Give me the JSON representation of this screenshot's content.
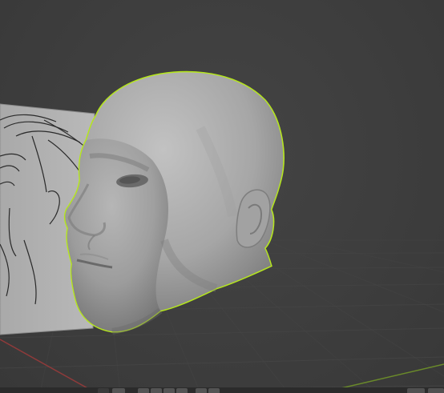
{
  "window": {
    "app": "blender",
    "view": "3d-viewport",
    "mode": "object-mode"
  },
  "scene": {
    "selected_object": "head-sculpt",
    "reference_image": "face-sketch-reference",
    "selection_outline_color": "#b5e61d",
    "background_color": "#3d3d3d",
    "grid_color": "#4a4a4a",
    "x_axis_color": "#8f3a3a",
    "y_axis_color": "#6a8a2a"
  },
  "toolbar": {
    "buttons": [
      {
        "icon": "tool-icon"
      },
      {
        "icon": "select-icon"
      },
      {
        "icon": "move-icon"
      },
      {
        "icon": "rotate-icon"
      },
      {
        "icon": "scale-icon"
      },
      {
        "icon": "transform-icon"
      },
      {
        "icon": "annotate-icon"
      },
      {
        "icon": "measure-icon"
      }
    ],
    "right_buttons": [
      {
        "icon": "overlay-icon"
      },
      {
        "icon": "shading-icon"
      }
    ]
  }
}
